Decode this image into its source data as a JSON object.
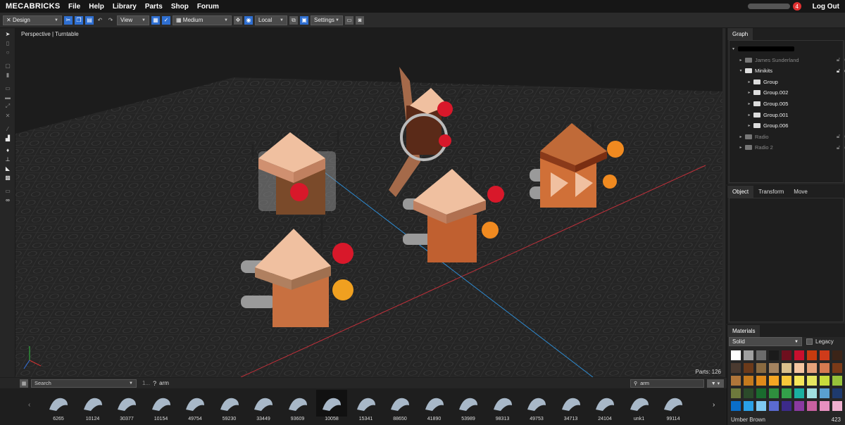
{
  "app": {
    "logo_text": "MECABRICKS"
  },
  "menu": [
    "File",
    "Help",
    "Library",
    "Parts",
    "Shop",
    "Forum"
  ],
  "user": {
    "notifications": "4",
    "logout_label": "Log Out"
  },
  "toolbar": {
    "mode": "Design",
    "view": "View",
    "quality": "Medium",
    "space": "Local",
    "settings": "Settings"
  },
  "viewport": {
    "label": "Perspective | Turntable",
    "parts_count": "Parts: 126"
  },
  "graph": {
    "tab": "Graph",
    "items": [
      {
        "label": "James Sunderland",
        "indent": 1,
        "arrow": "▸",
        "dim": true
      },
      {
        "label": "Minikits",
        "indent": 1,
        "arrow": "▾",
        "dim": false
      },
      {
        "label": "Group",
        "indent": 2,
        "arrow": "▸",
        "dim": false
      },
      {
        "label": "Group.002",
        "indent": 2,
        "arrow": "▸",
        "dim": false
      },
      {
        "label": "Group.005",
        "indent": 2,
        "arrow": "▸",
        "dim": false
      },
      {
        "label": "Group.001",
        "indent": 2,
        "arrow": "▸",
        "dim": false
      },
      {
        "label": "Group.006",
        "indent": 2,
        "arrow": "▸",
        "dim": false
      },
      {
        "label": "Radio",
        "indent": 1,
        "arrow": "▸",
        "dim": true
      },
      {
        "label": "Radio 2",
        "indent": 1,
        "arrow": "▸",
        "dim": true
      }
    ]
  },
  "properties": {
    "tabs": [
      "Object",
      "Transform",
      "Move"
    ]
  },
  "materials": {
    "tab": "Materials",
    "type": "Solid",
    "legacy_label": "Legacy",
    "selected_name": "Umber Brown",
    "selected_id": "423",
    "swatches": [
      "#ffffff",
      "#a0a0a0",
      "#6b6b6b",
      "#1b1b1b",
      "#6e0f1e",
      "#c8102e",
      "#c73b0f",
      "#cf3b1a",
      "#3b2418",
      "#4a3a30",
      "#6b3a1a",
      "#8a6a40",
      "#a58460",
      "#d9c08c",
      "#f5c5a0",
      "#e6a27a",
      "#d67a50",
      "#7a3a18",
      "#b0763a",
      "#c47a1e",
      "#e08a1a",
      "#f5a623",
      "#f8c93a",
      "#f5e65a",
      "#e6e660",
      "#c8dc3c",
      "#97c23a",
      "#6e7a3c",
      "#2b4a2a",
      "#1a6b2e",
      "#2f8f3e",
      "#33a14a",
      "#1ab0a0",
      "#a0e0e0",
      "#5aa0d0",
      "#1e3a6e",
      "#0a6ec8",
      "#2aa0e6",
      "#7ec8f0",
      "#5a6ad0",
      "#3c2a8a",
      "#8a3aa0",
      "#c860a0",
      "#e890c0",
      "#f0b0d0"
    ]
  },
  "library": {
    "search_placeholder": "Search",
    "page_indicator": "1...",
    "help": "?",
    "query": "arm",
    "filter_value": "arm",
    "parts": [
      "6265",
      "10124",
      "30377",
      "10154",
      "49754",
      "59230",
      "33449",
      "93609",
      "10058",
      "15341",
      "88650",
      "41890",
      "53989",
      "98313",
      "49753",
      "34713",
      "24104",
      "unk1",
      "99114"
    ]
  }
}
